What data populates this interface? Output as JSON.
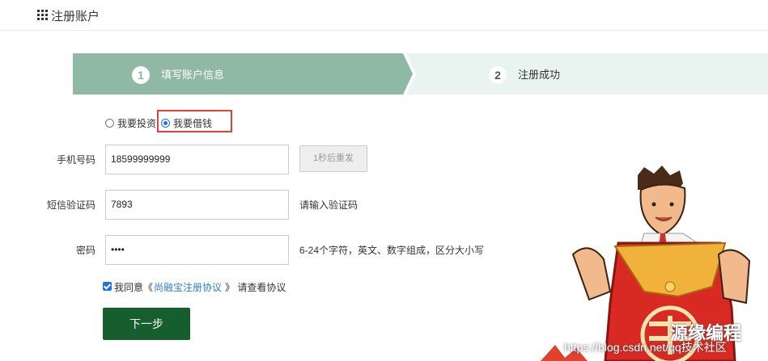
{
  "header": {
    "title": "注册账户",
    "icon": "grid-icon"
  },
  "steps": [
    {
      "number": "1",
      "label": "填写账户信息",
      "active": true
    },
    {
      "number": "2",
      "label": "注册成功",
      "active": false
    }
  ],
  "colors": {
    "step_active": "#8fb8a5",
    "step_inactive": "#e9f4f1",
    "primary_button": "#175e2e",
    "link": "#2b7fc3",
    "highlight": "#e0403a"
  },
  "role": {
    "options": [
      {
        "label": "我要投资",
        "selected": false
      },
      {
        "label": "我要借钱",
        "selected": true
      }
    ]
  },
  "form": {
    "phone": {
      "label": "手机号码",
      "value": "18599999999",
      "resend_label": "1秒后重发"
    },
    "sms": {
      "label": "短信验证码",
      "value": "7893",
      "hint": "请输入验证码"
    },
    "password": {
      "label": "密码",
      "value": "••••",
      "hint": "6-24个字符，英文、数字组成，区分大小写"
    }
  },
  "agreement": {
    "checked": true,
    "prefix": "我同意《",
    "link": "尚融宝注册协议",
    "suffix": "》 请查看协议"
  },
  "next_button": "下一步",
  "watermark": {
    "brand": "源缘编程",
    "url": "https://blog.csdn.net/qq技术社区"
  }
}
